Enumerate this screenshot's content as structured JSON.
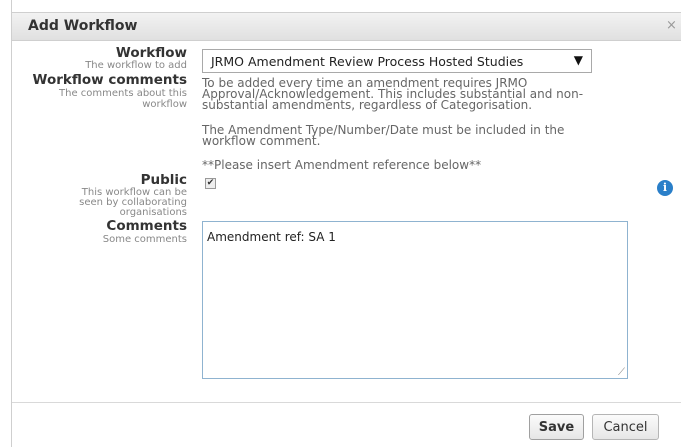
{
  "dialog": {
    "title": "Add Workflow",
    "close_label": "×"
  },
  "fields": {
    "workflow": {
      "label": "Workflow",
      "sublabel": "The workflow to add",
      "selected": "JRMO Amendment Review Process Hosted Studies",
      "arrow": "▼"
    },
    "workflow_comments": {
      "label": "Workflow comments",
      "sublabel_1": "The comments about this",
      "sublabel_2": "workflow",
      "text_1": "To be added every time an amendment requires JRMO",
      "text_2": "Approval/Acknowledgement. This includes substantial and non-",
      "text_3": "substantial amendments, regardless of Categorisation.",
      "text_4": "The Amendment Type/Number/Date must be included in the",
      "text_5": "workflow comment.",
      "text_6": "**Please insert Amendment reference below**"
    },
    "public": {
      "label": "Public",
      "sublabel_1": "This workflow can be",
      "sublabel_2": "seen by collaborating",
      "sublabel_3": "organisations",
      "checked": true,
      "check_glyph": "✔"
    },
    "comments": {
      "label": "Comments",
      "sublabel": "Some comments",
      "value": "Amendment ref: SA 1"
    }
  },
  "icons": {
    "info": "i",
    "resize": "⟋"
  },
  "buttons": {
    "save": "Save",
    "cancel": "Cancel"
  },
  "colors": {
    "info_icon": "#2a7fc9",
    "textarea_border": "#8fb3d0"
  }
}
